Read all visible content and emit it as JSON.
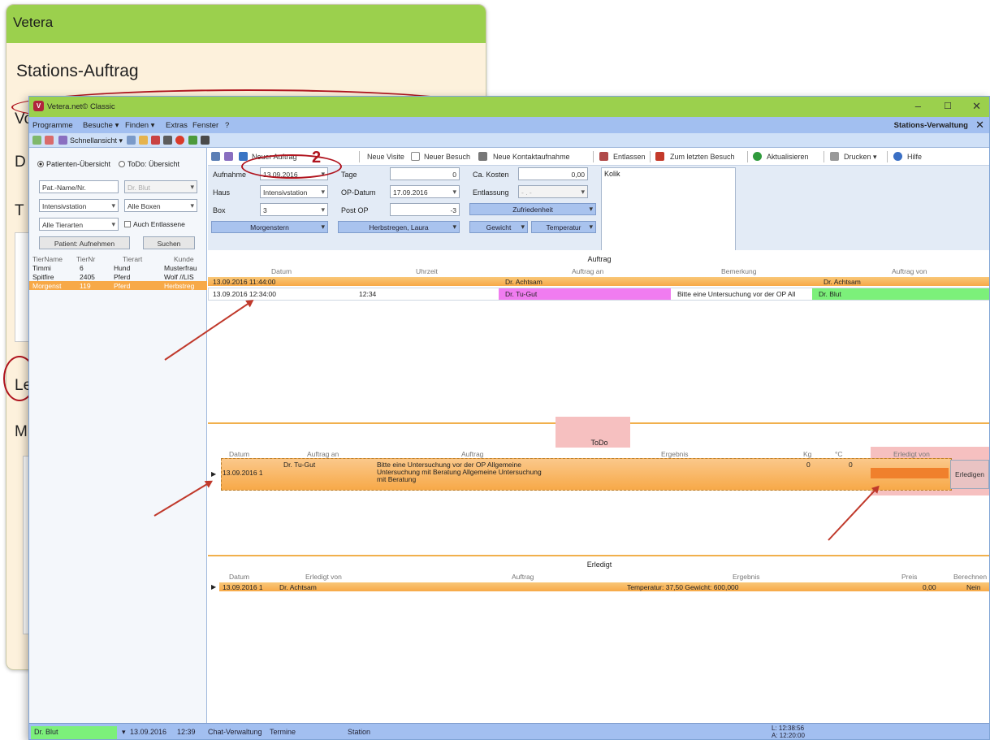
{
  "background": {
    "app_name": "Vetera",
    "page_title": "Stations-Auftrag",
    "fragments": [
      "Vo",
      "D",
      "T",
      "Le",
      "M"
    ]
  },
  "window": {
    "title": "Vetera.net© Classic",
    "menu": [
      "Programme",
      "Besuche ▾",
      "Finden ▾",
      "Extras",
      "Fenster",
      "?"
    ],
    "panel_title": "Stations-Verwaltung",
    "quickview": "Schnellansicht ▾"
  },
  "left": {
    "radio1": "Patienten-Übersicht",
    "radio2": "ToDo: Übersicht",
    "f_name": "Pat.-Name/Nr.",
    "f_doc": "Dr. Blut",
    "f_station": "Intensivstation",
    "f_boxes": "Alle Boxen",
    "f_species": "Alle Tierarten",
    "chk_label": "Auch Entlassene",
    "btn_admit": "Patient: Aufnehmen",
    "btn_search": "Suchen",
    "headers": [
      "TierName",
      "TierNr",
      "Tierart",
      "Kunde"
    ],
    "rows": [
      [
        "Timmi",
        "6",
        "Hund",
        "Musterfrau"
      ],
      [
        "Spitfire",
        "2405",
        "Pferd",
        "Wolf //LIS"
      ],
      [
        "Morgenst",
        "119",
        "Pferd",
        "Herbstreg"
      ]
    ]
  },
  "toolbar": {
    "neuer_auftrag": "Neuer Auftrag",
    "neue_visite": "Neue Visite",
    "neuer_besuch": "Neuer Besuch",
    "neue_kontakt": "Neue Kontaktaufnahme",
    "entlassen": "Entlassen",
    "zum_letzten": "Zum letzten Besuch",
    "aktualisieren": "Aktualisieren",
    "drucken": "Drucken ▾",
    "hilfe": "Hilfe",
    "marker": "2"
  },
  "form": {
    "l_aufnahme": "Aufnahme",
    "v_aufnahme": "13.09.2016",
    "l_haus": "Haus",
    "v_haus": "Intensivstation",
    "l_box": "Box",
    "v_box": "3",
    "l_tage": "Tage",
    "v_tage": "0",
    "l_opdatum": "OP-Datum",
    "v_opdatum": "17.09.2016",
    "l_postop": "Post OP",
    "v_postop": "-3",
    "l_kosten": "Ca. Kosten",
    "v_kosten": "0,00",
    "l_entlassung": "Entlassung",
    "v_entlassung": "- . -",
    "zufrieden": "Zufriedenheit",
    "patient_btn": "Morgenstern",
    "owner_btn": "Herbstregen, Laura",
    "gewicht": "Gewicht",
    "temperatur": "Temperatur",
    "notes": "Kolik"
  },
  "auftrag": {
    "caption": "Auftrag",
    "headers": [
      "Datum",
      "Uhrzeit",
      "Auftrag an",
      "Bemerkung",
      "Auftrag von"
    ],
    "row1": {
      "datum": "13.09.2016 11:44:00",
      "an": "Dr. Achtsam",
      "von": "Dr. Achtsam"
    },
    "row2": {
      "datum": "13.09.2016 12:34:00",
      "uhrzeit": "12:34",
      "an": "Dr. Tu-Gut",
      "bemerkung": "Bitte eine Untersuchung vor der OP All",
      "von": "Dr. Blut"
    }
  },
  "todo": {
    "caption": "ToDo",
    "headers": [
      "Datum",
      "Auftrag an",
      "Auftrag",
      "Ergebnis",
      "Kg",
      "°C",
      "Erledigt von"
    ],
    "row": {
      "datum": "13.09.2016 1",
      "an": "Dr. Tu-Gut",
      "auftrag1": "Bitte eine Untersuchung vor der OP Allgemeine",
      "auftrag2": "Untersuchung mit Beratung Allgemeine Untersuchung",
      "auftrag3": "mit Beratung",
      "kg": "0",
      "c": "0",
      "btn": "Erledigen"
    }
  },
  "erledigt": {
    "caption": "Erledigt",
    "headers": [
      "Datum",
      "Erledigt von",
      "Auftrag",
      "Ergebnis",
      "Preis",
      "Berechnen"
    ],
    "row": {
      "datum": "13.09.2016 1",
      "von": "Dr. Achtsam",
      "ergebnis": "Temperatur: 37,50 Gewicht: 600,000",
      "preis": "0,00",
      "berechnen": "Nein"
    }
  },
  "status": {
    "user": "Dr. Blut",
    "date": "13.09.2016",
    "time": "12:39",
    "tab1": "Chat-Verwaltung",
    "tab2": "Termine",
    "tab3": "Station",
    "t1": "L: 12:38:56",
    "t2": "A: 12:20:00"
  },
  "colors": {
    "green": "#9bd04d",
    "blue": "#a2bff0",
    "orange": "#f7a948",
    "pink": "#f07cf0",
    "lightgreen": "#7cf07a",
    "todo_pink": "#f6c0c0"
  }
}
